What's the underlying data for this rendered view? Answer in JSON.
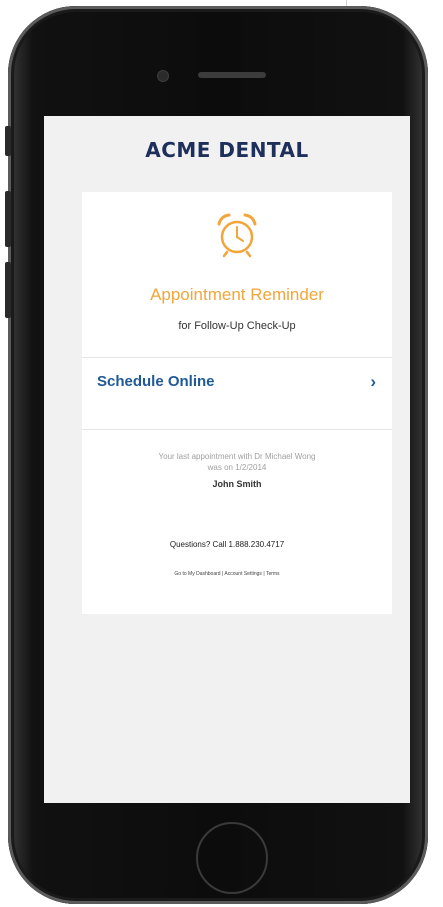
{
  "brand": {
    "name": "ACME DENTAL"
  },
  "reminder": {
    "icon": "alarm-clock-icon",
    "title": "Appointment Reminder",
    "subtitle": "for Follow-Up Check-Up",
    "accent_color": "#f2a63a"
  },
  "schedule": {
    "label": "Schedule Online",
    "chevron": "›",
    "color": "#1f5a96"
  },
  "last_appointment": {
    "line1": "Your last appointment with Dr Michael Wong",
    "line2": "was on 1/2/2014",
    "patient_name": "John Smith"
  },
  "footer": {
    "questions": "Questions? Call 1.888.230.4717",
    "links": [
      "Go to My Dashboard",
      "Account Settings",
      "Terms"
    ],
    "separator": "|"
  },
  "colors": {
    "brand_navy": "#1f2f5b",
    "screen_bg": "#f1f1f1",
    "card_bg": "#ffffff"
  }
}
